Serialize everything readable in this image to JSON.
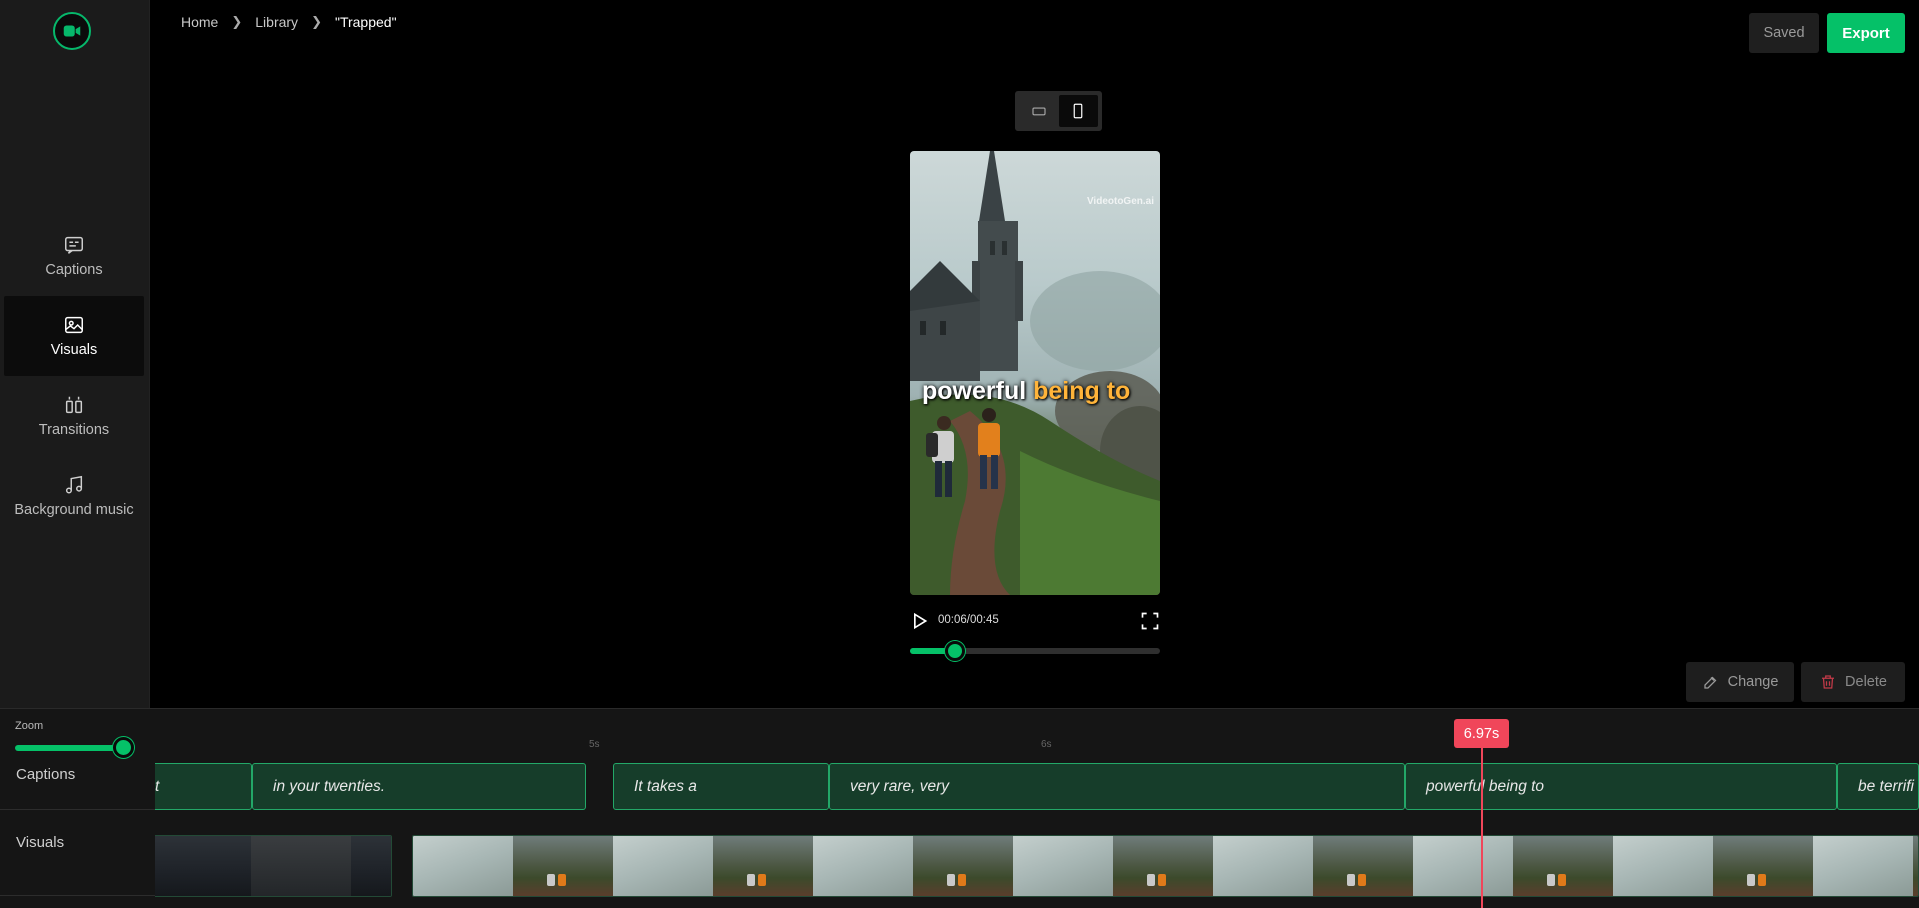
{
  "breadcrumb": {
    "home": "Home",
    "library": "Library",
    "current": "\"Trapped\""
  },
  "header": {
    "saved_label": "Saved",
    "export_label": "Export"
  },
  "sidebar": {
    "items": [
      {
        "label": "Captions",
        "icon": "captions-icon"
      },
      {
        "label": "Visuals",
        "icon": "image-icon"
      },
      {
        "label": "Transitions",
        "icon": "transitions-icon"
      },
      {
        "label": "Background music",
        "icon": "music-icon"
      }
    ],
    "active": "Visuals"
  },
  "preview": {
    "caption_word_1": "powerful",
    "caption_word_2": "being to",
    "watermark": "VideotoGen.ai",
    "caption_highlight_color": "#ffb43a"
  },
  "player": {
    "time": "00:06/00:45",
    "progress_fraction": 0.18
  },
  "actions": {
    "change_label": "Change",
    "delete_label": "Delete"
  },
  "timeline": {
    "zoom_label": "Zoom",
    "zoom_fraction": 1.0,
    "rows": {
      "captions": "Captions",
      "visuals": "Visuals"
    },
    "ruler": [
      "5s",
      "6s"
    ],
    "caption_blocks": [
      "t",
      "in your twenties.",
      "It takes a",
      "very rare, very",
      "powerful being to",
      "be terrifi"
    ],
    "playhead_label": "6.97s"
  },
  "colors": {
    "accent": "#05c168",
    "playhead": "#f0465a"
  }
}
